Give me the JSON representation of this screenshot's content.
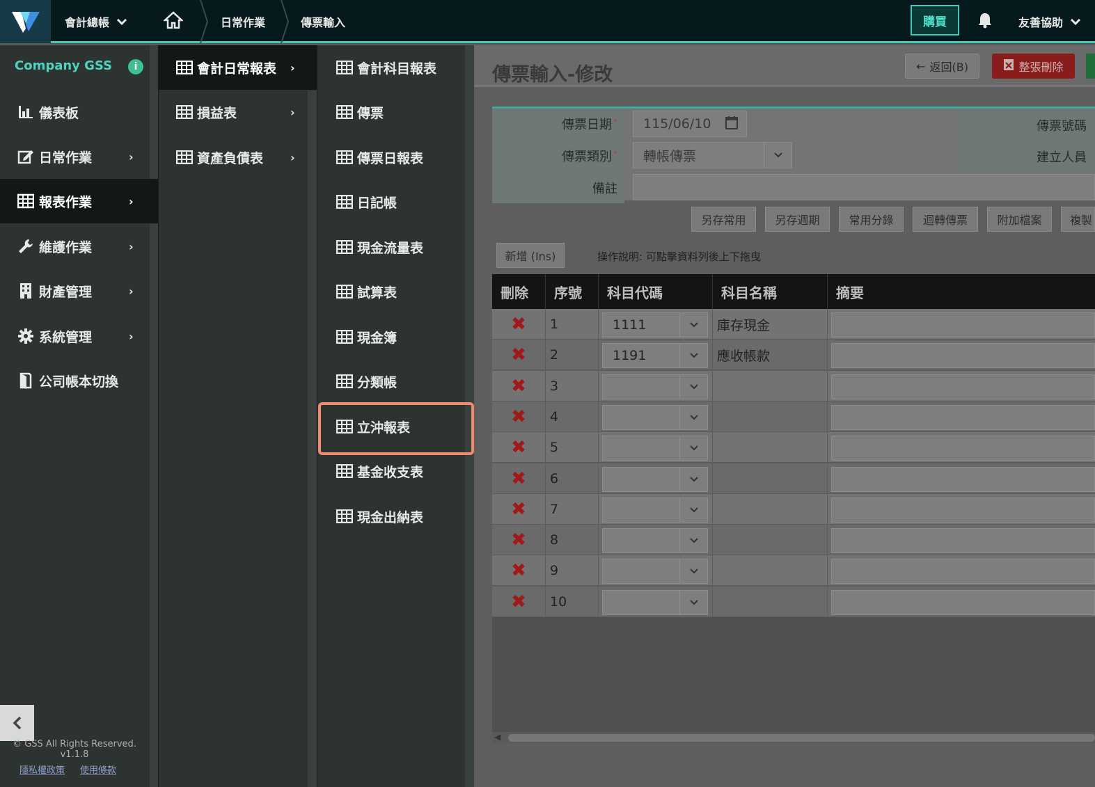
{
  "topbar": {
    "module_label": "會計總帳",
    "home_icon": "home-icon",
    "breadcrumb": [
      "日常作業",
      "傳票輸入"
    ],
    "buy_label": "購買",
    "bell_icon": "bell-icon",
    "help_label": "友善協助"
  },
  "sidebar": {
    "company": "Company GSS",
    "items": [
      {
        "label": "儀表板",
        "icon": "dashboard-icon",
        "has_arrow": false
      },
      {
        "label": "日常作業",
        "icon": "edit-icon",
        "has_arrow": true
      },
      {
        "label": "報表作業",
        "icon": "table-icon",
        "has_arrow": true,
        "active": true
      },
      {
        "label": "維護作業",
        "icon": "wrench-icon",
        "has_arrow": true
      },
      {
        "label": "財產管理",
        "icon": "building-icon",
        "has_arrow": true
      },
      {
        "label": "系統管理",
        "icon": "gear-icon",
        "has_arrow": true
      },
      {
        "label": "公司帳本切換",
        "icon": "book-icon",
        "has_arrow": false
      }
    ],
    "footer_copyright": "© GSS All Rights Reserved.",
    "footer_version": "v1.1.8",
    "privacy_link": "隱私權政策",
    "terms_link": "使用條款"
  },
  "submenu": {
    "items": [
      {
        "label": "會計日常報表",
        "active": true
      },
      {
        "label": "損益表"
      },
      {
        "label": "資產負債表"
      }
    ]
  },
  "reports": {
    "items": [
      "會計科目報表",
      "傳票",
      "傳票日報表",
      "日記帳",
      "現金流量表",
      "試算表",
      "現金簿",
      "分類帳",
      "立沖報表",
      "基金收支表",
      "現金出納表"
    ],
    "highlighted": "立沖報表"
  },
  "main": {
    "title": "傳票輸入-修改",
    "back_label": "返回(B)",
    "delete_all_label": "整張刪除",
    "form": {
      "date_label": "傳票日期",
      "date_value": "115/06/10",
      "type_label": "傳票類別",
      "type_value": "轉帳傳票",
      "memo_label": "備註",
      "number_label": "傳票號碼",
      "creator_label": "建立人員"
    },
    "actions": [
      "另存常用",
      "另存週期",
      "常用分錄",
      "迴轉傳票",
      "附加檔案",
      "複製"
    ],
    "add_label": "新增 (Ins)",
    "op_note": "操作說明: 可點擊資料列後上下拖曳",
    "columns": [
      "刪除",
      "序號",
      "科目代碼",
      "科目名稱",
      "摘要"
    ],
    "rows": [
      {
        "no": "1",
        "code": "1111",
        "name": "庫存現金"
      },
      {
        "no": "2",
        "code": "1191",
        "name": "應收帳款"
      },
      {
        "no": "3",
        "code": "",
        "name": ""
      },
      {
        "no": "4",
        "code": "",
        "name": ""
      },
      {
        "no": "5",
        "code": "",
        "name": ""
      },
      {
        "no": "6",
        "code": "",
        "name": ""
      },
      {
        "no": "7",
        "code": "",
        "name": ""
      },
      {
        "no": "8",
        "code": "",
        "name": ""
      },
      {
        "no": "9",
        "code": "",
        "name": ""
      },
      {
        "no": "10",
        "code": "",
        "name": ""
      }
    ]
  }
}
